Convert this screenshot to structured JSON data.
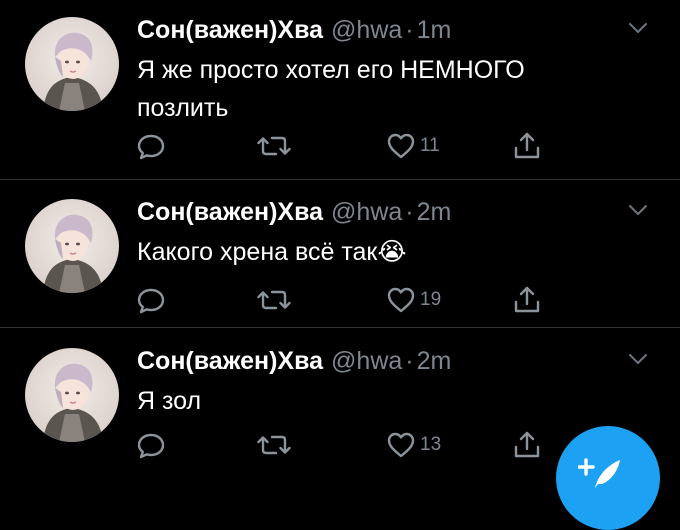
{
  "tweets": [
    {
      "name": "Сон(важен)Хва",
      "handle": "@hwa",
      "separator": "·",
      "time": "1m",
      "text": "Я же просто хотел его НЕМНОГО позлить",
      "likes": "11"
    },
    {
      "name": "Сон(важен)Хва",
      "handle": "@hwa",
      "separator": "·",
      "time": "2m",
      "text": "Какого хрена всё так😭",
      "likes": "19"
    },
    {
      "name": "Сон(важен)Хва",
      "handle": "@hwa",
      "separator": "·",
      "time": "2m",
      "text": "Я зол",
      "likes": "13"
    }
  ],
  "icons": {
    "reply": "reply-icon",
    "retweet": "retweet-icon",
    "like": "heart-icon",
    "share": "share-icon",
    "menu": "chevron-down-icon",
    "compose": "compose-tweet-icon"
  },
  "colors": {
    "background": "#000000",
    "text": "#ffffff",
    "muted": "#7d8790",
    "divider": "#2f3336",
    "accent": "#1da1f2"
  }
}
